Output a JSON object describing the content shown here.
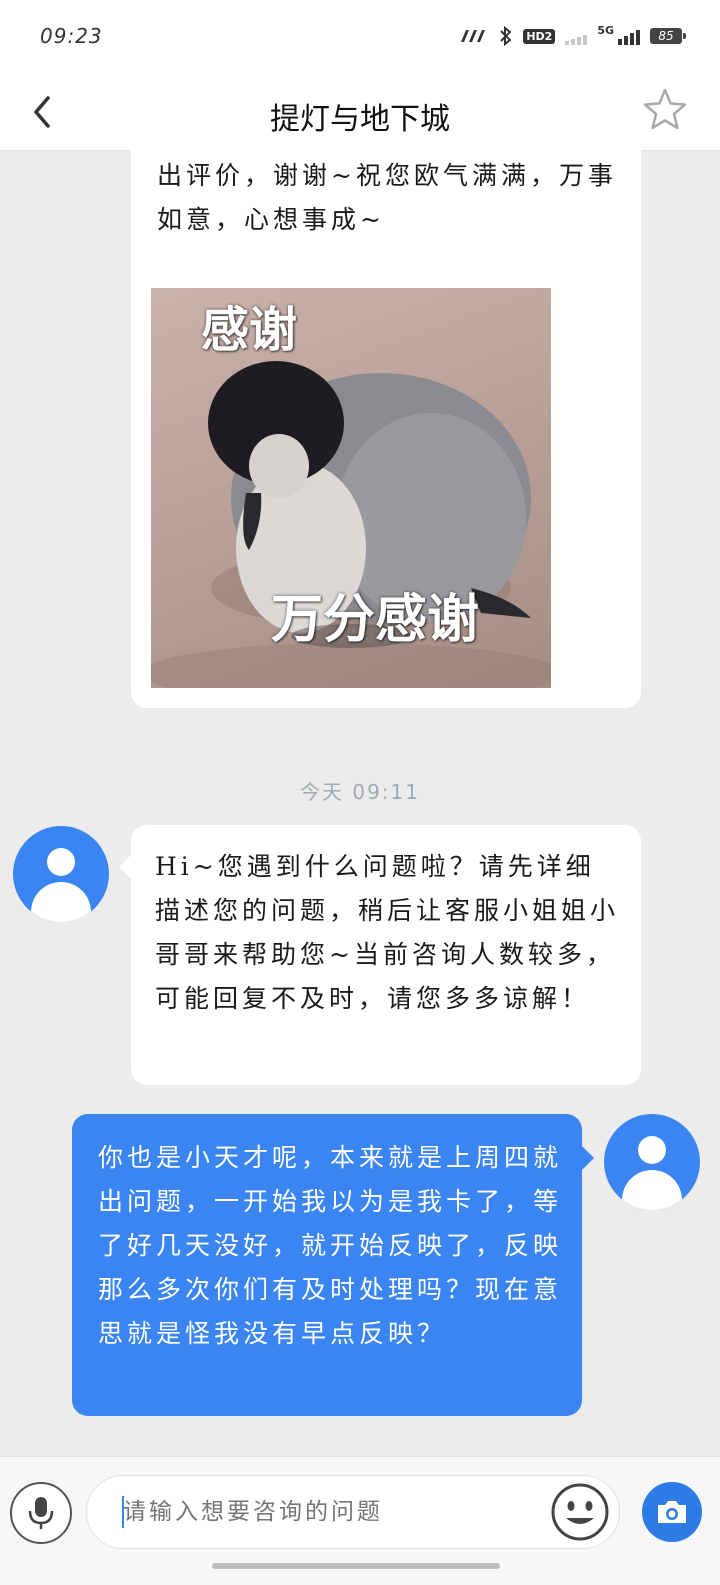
{
  "status_bar": {
    "time": "09:23",
    "hd_label": "HD2",
    "network_label": "5G",
    "battery": "85"
  },
  "header": {
    "title": "提灯与地下城",
    "back_icon": "chevron-left-icon",
    "favorite_icon": "star-outline-icon"
  },
  "messages": [
    {
      "side": "left",
      "text": "出评价，谢谢~祝您欧气满满，万事如意，心想事成~",
      "sticker": {
        "caption_top": "感谢",
        "caption_bottom": "万分感谢"
      }
    },
    {
      "side": "left",
      "text": "Hi~您遇到什么问题啦？请先详细描述您的问题，稍后让客服小姐姐小哥哥来帮助您~当前咨询人数较多，可能回复不及时，请您多多谅解！"
    },
    {
      "side": "right",
      "text": "你也是小天才呢，本来就是上周四就出问题，一开始我以为是我卡了，等了好几天没好，就开始反映了，反映那么多次你们有及时处理吗？现在意思就是怪我没有早点反映？"
    }
  ],
  "timestamp": "今天 09:11",
  "input_bar": {
    "placeholder": "请输入想要咨询的问题",
    "value": ""
  },
  "colors": {
    "accent": "#3a85f2",
    "background": "#ececec",
    "timestamp_text": "#a2a9b3"
  }
}
